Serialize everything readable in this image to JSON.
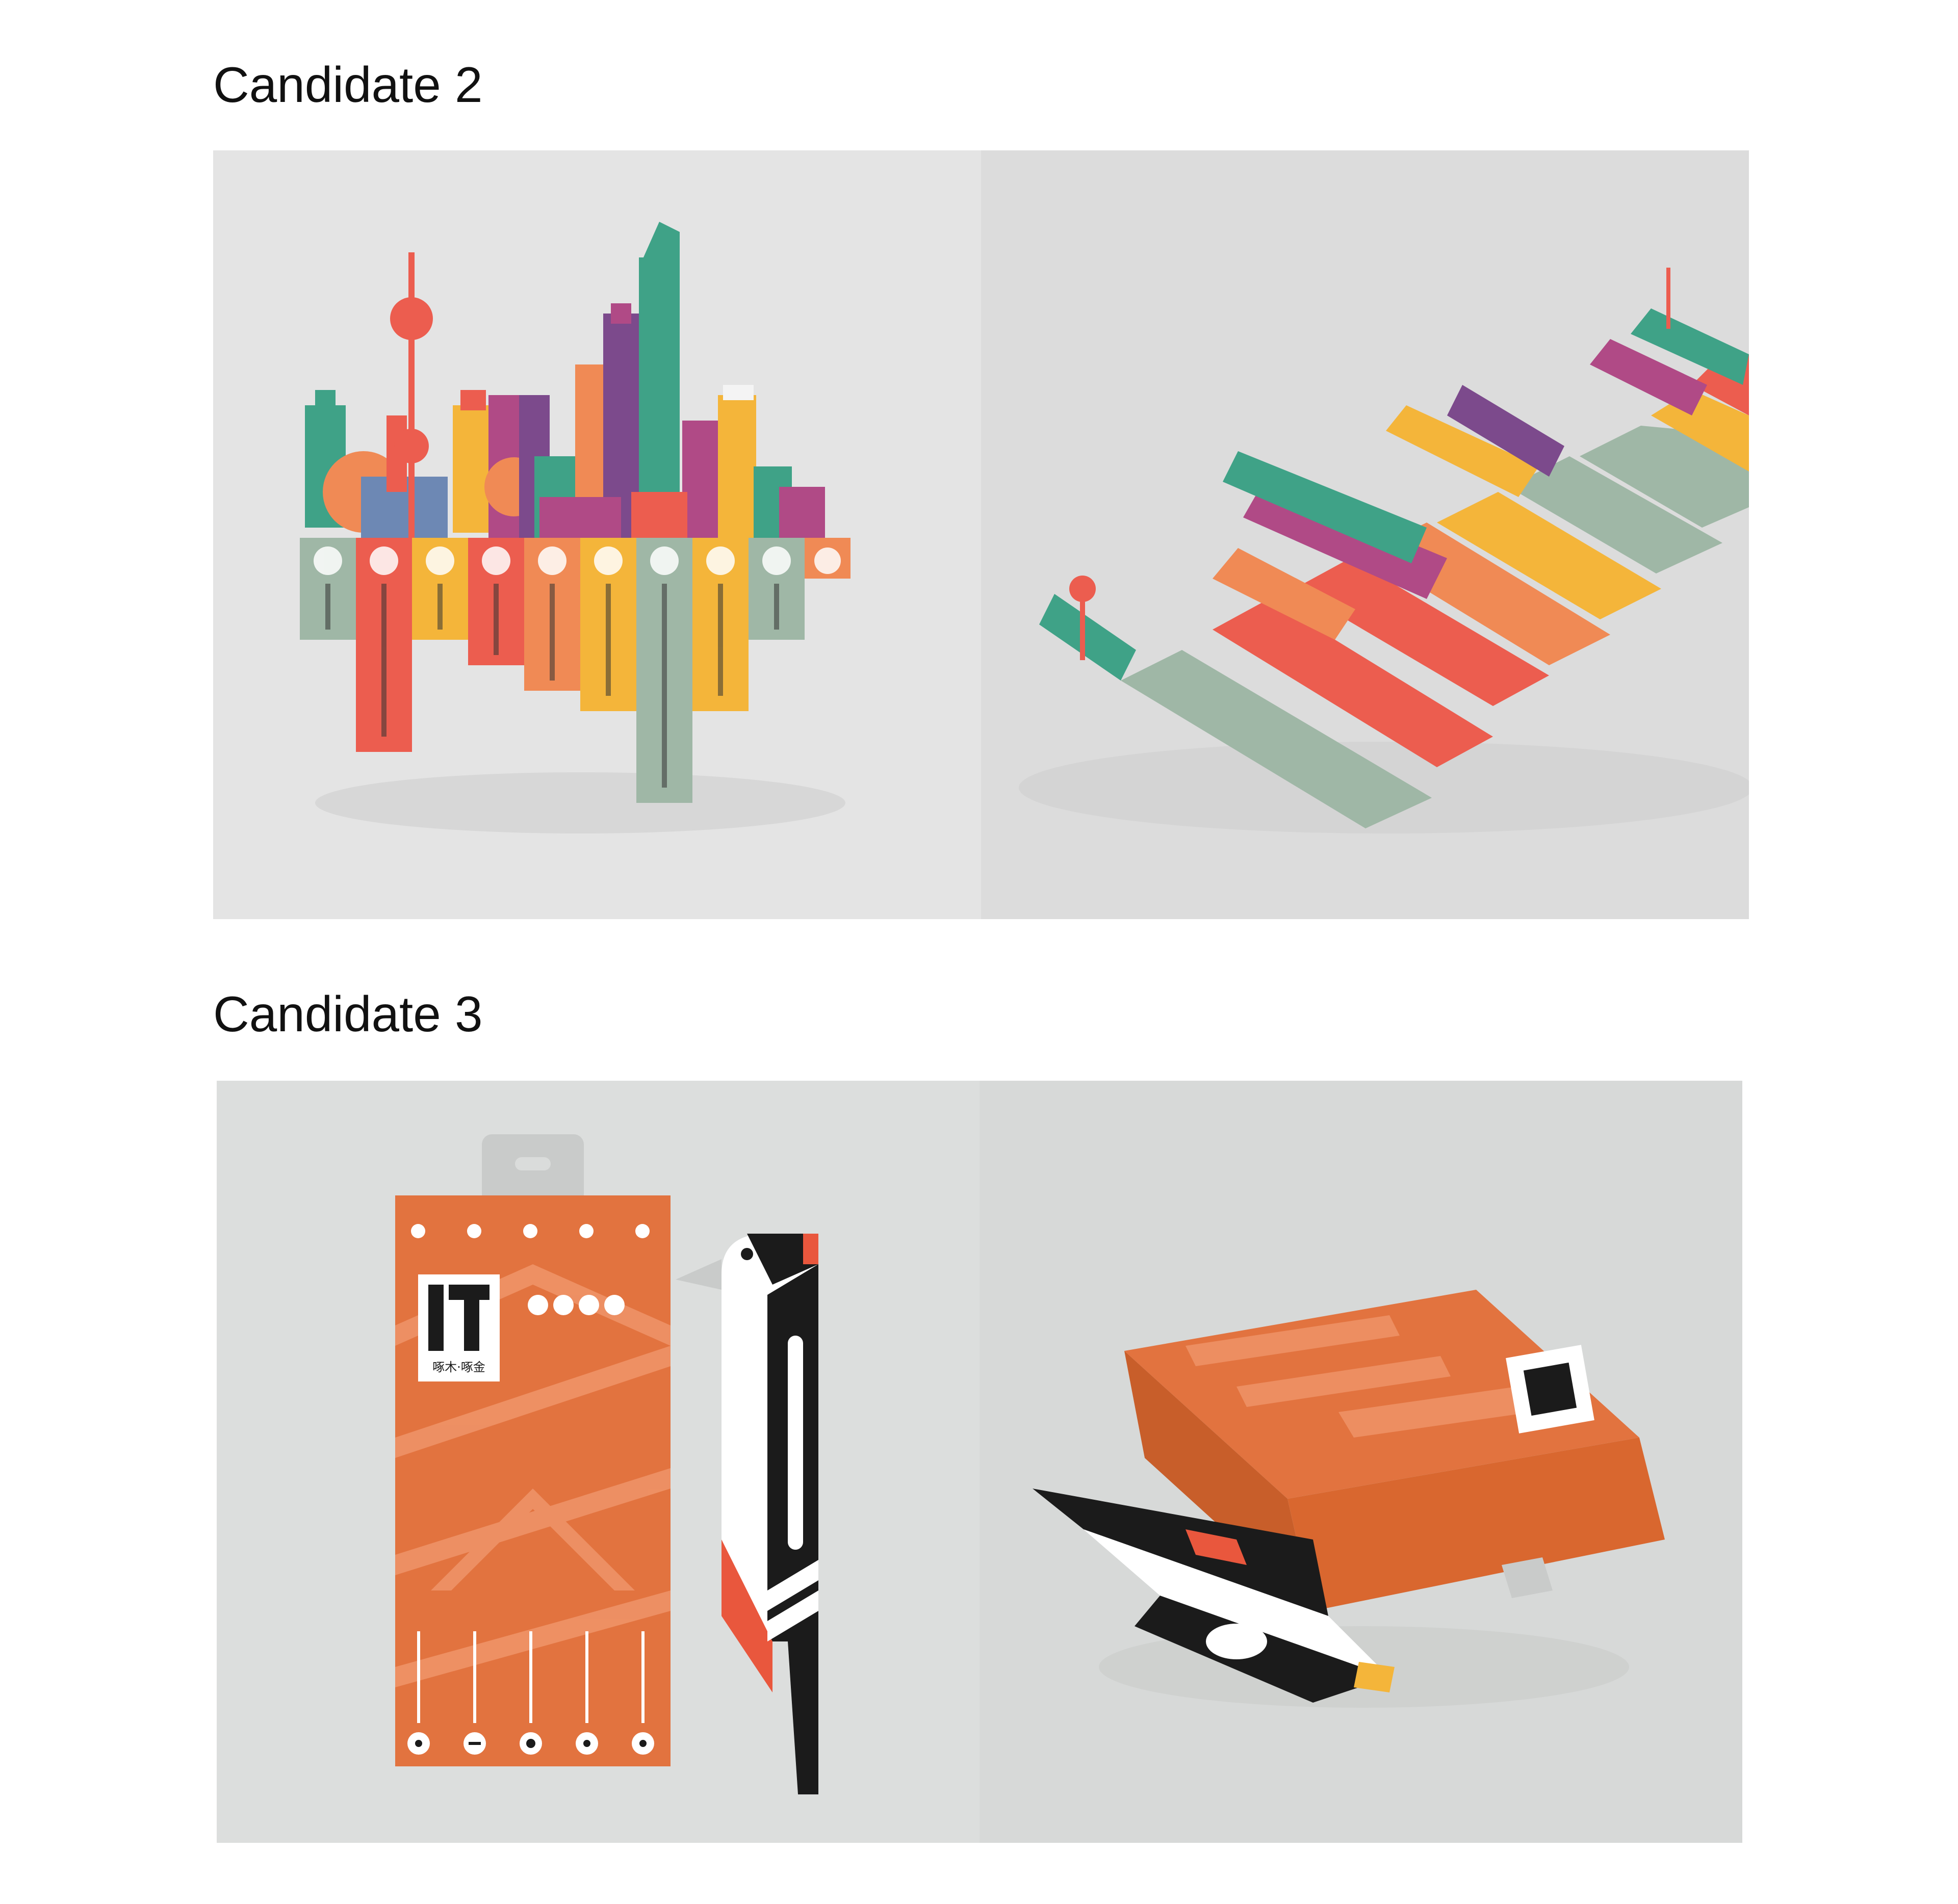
{
  "sections": [
    {
      "heading": "Candidate 2"
    },
    {
      "heading": "Candidate 3"
    }
  ],
  "candidate2": {
    "left_render": "skyline-packaging-front-view",
    "right_render": "skyline-packaging-perspective-view",
    "colors": {
      "background": "#e2e2e2",
      "coral": "#ec5d4f",
      "orange": "#f08a55",
      "yellow": "#f4b53a",
      "sage": "#9fb7a6",
      "teal": "#3fa287",
      "magenta": "#b04a86",
      "purple": "#7c4a8c"
    },
    "screw_head_icons": [
      "cross-head",
      "flat-head",
      "hex-head",
      "star-head",
      "hex-head",
      "cross-head",
      "flat-head",
      "hex-head",
      "star-head",
      "hex-head"
    ]
  },
  "candidate3": {
    "left_render": "woodpecker-box-front-view",
    "right_render": "woodpecker-box-perspective-view",
    "logo_text": "啄木·啄金",
    "colors": {
      "background": "#dadcdb",
      "box_orange": "#e2733f",
      "box_pattern": "#f0956a",
      "bird_black": "#1b1b1b",
      "bird_red": "#e9573d",
      "bird_white": "#ffffff"
    },
    "screw_head_icons": [
      "cross-head",
      "flat-head",
      "hex-head",
      "star-head",
      "cross-head"
    ]
  }
}
